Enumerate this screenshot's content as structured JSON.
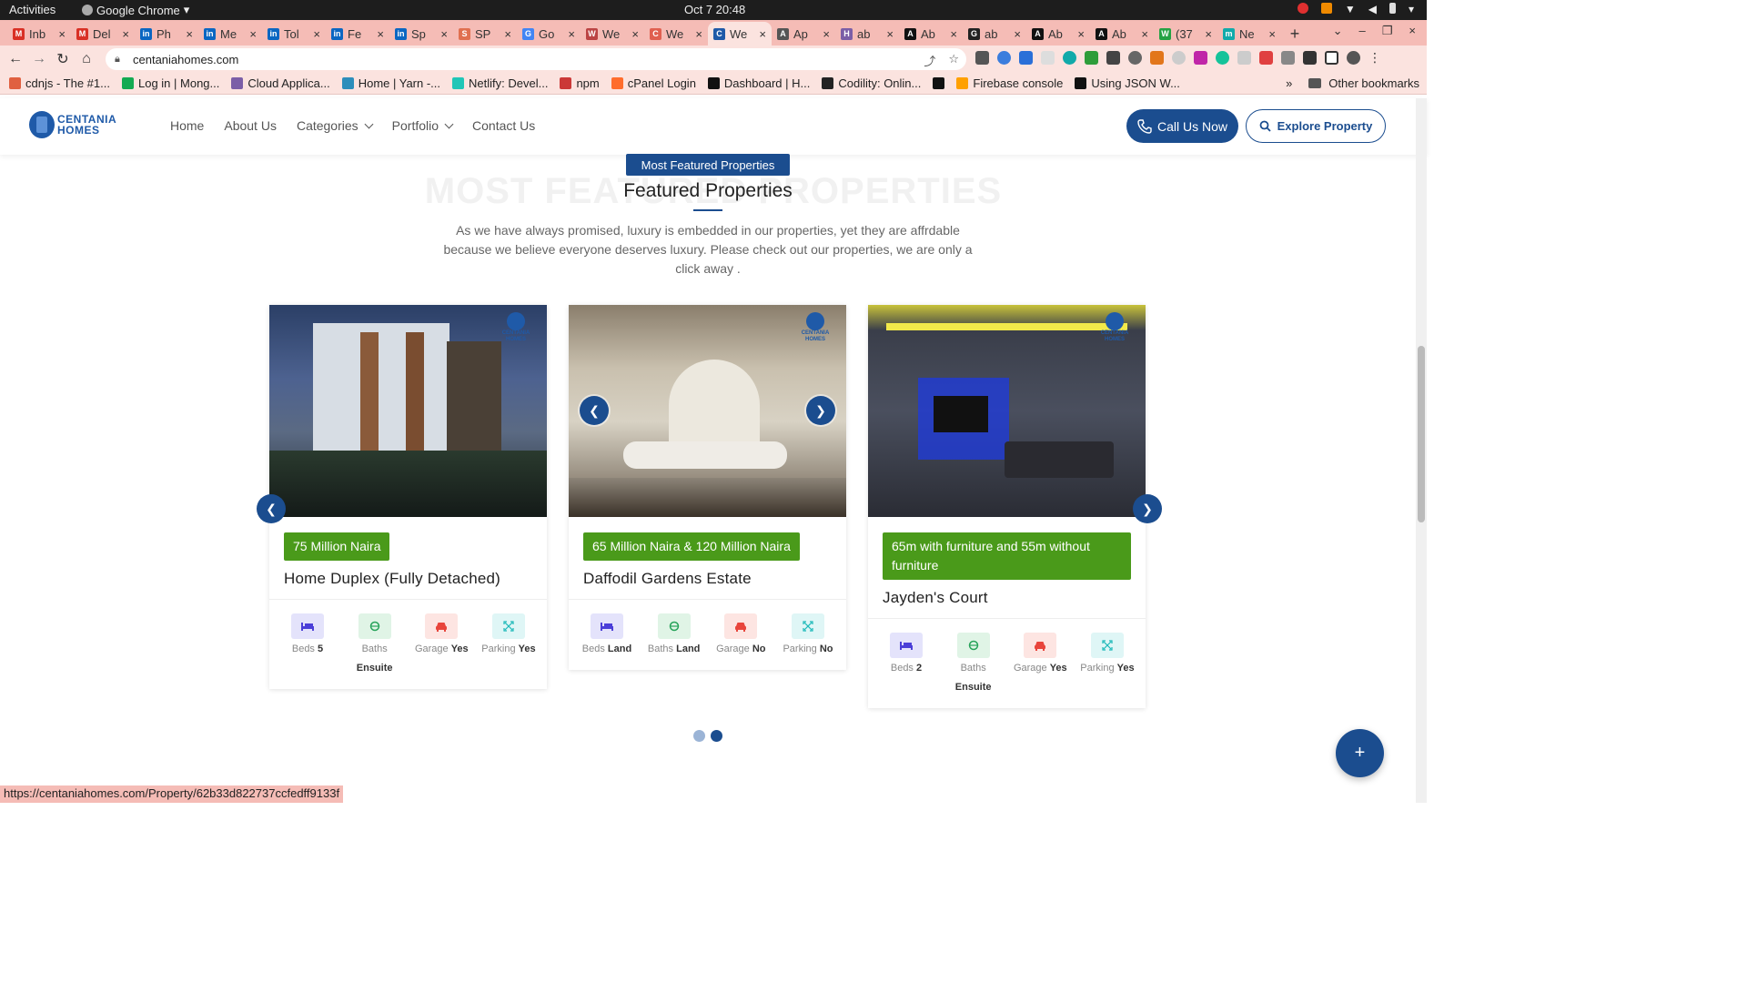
{
  "os": {
    "activities": "Activities",
    "app": "Google Chrome",
    "clock": "Oct 7  20:48"
  },
  "tabs": [
    {
      "label": "Inb",
      "color": "#d93025",
      "glyph": "M"
    },
    {
      "label": "Del",
      "color": "#d93025",
      "glyph": "M"
    },
    {
      "label": "Ph",
      "color": "#0a66c2",
      "glyph": "in"
    },
    {
      "label": "Me",
      "color": "#0a66c2",
      "glyph": "in"
    },
    {
      "label": "Tol",
      "color": "#0a66c2",
      "glyph": "in"
    },
    {
      "label": "Fe",
      "color": "#0a66c2",
      "glyph": "in"
    },
    {
      "label": "Sp",
      "color": "#0a66c2",
      "glyph": "in"
    },
    {
      "label": "SP",
      "color": "#e07050",
      "glyph": "S"
    },
    {
      "label": "Go",
      "color": "#4285f4",
      "glyph": "G"
    },
    {
      "label": "We",
      "color": "#b44",
      "glyph": "W"
    },
    {
      "label": "We",
      "color": "#e06050",
      "glyph": "C"
    },
    {
      "label": "We",
      "color": "#1f5aa8",
      "glyph": "C",
      "active": true
    },
    {
      "label": "Ap",
      "color": "#555",
      "glyph": "A"
    },
    {
      "label": "ab",
      "color": "#7b5ea7",
      "glyph": "H"
    },
    {
      "label": "Ab",
      "color": "#111",
      "glyph": "A"
    },
    {
      "label": "ab",
      "color": "#222",
      "glyph": "G"
    },
    {
      "label": "Ab",
      "color": "#111",
      "glyph": "A"
    },
    {
      "label": "Ab",
      "color": "#111",
      "glyph": "A"
    },
    {
      "label": "(37",
      "color": "#25a244",
      "glyph": "W"
    },
    {
      "label": "Ne",
      "color": "#1aa",
      "glyph": "m"
    }
  ],
  "toolbar": {
    "url": "centaniahomes.com"
  },
  "bookmarks": [
    {
      "label": "cdnjs - The #1...",
      "color": "#e06040"
    },
    {
      "label": "Log in | Mong...",
      "color": "#13aa52"
    },
    {
      "label": "Cloud Applica...",
      "color": "#7b5ea7"
    },
    {
      "label": "Home | Yarn -...",
      "color": "#2c8ebb"
    },
    {
      "label": "Netlify: Devel...",
      "color": "#20c6b7"
    },
    {
      "label": "npm",
      "color": "#cb3837"
    },
    {
      "label": "cPanel Login",
      "color": "#ff6c2c"
    },
    {
      "label": "Dashboard | H...",
      "color": "#111"
    },
    {
      "label": "Codility: Onlin...",
      "color": "#222"
    },
    {
      "label": "",
      "color": "#111"
    },
    {
      "label": "Firebase console",
      "color": "#ffa000"
    },
    {
      "label": "Using JSON W...",
      "color": "#111"
    }
  ],
  "bookmarks_more": "»",
  "other_bookmarks": "Other bookmarks",
  "site": {
    "logo_line1": "CENTANIA",
    "logo_line2": "HOMES",
    "nav": [
      "Home",
      "About Us",
      "Categories",
      "Portfolio",
      "Contact Us"
    ],
    "call_label": "Call Us Now",
    "explore_label": "Explore Property"
  },
  "section": {
    "badge": "Most Featured Properties",
    "ghost": "MOST FEATURED PROPERTIES",
    "title": "Featured Properties",
    "description": "As we have always promised, luxury is embedded in our properties, yet they are affrdable because we believe everyone deserves luxury. Please check out our properties, we are only a click away ."
  },
  "cards": [
    {
      "price": "75 Million Naira",
      "title": "Home Duplex (Fully Detached)",
      "beds_label": "Beds",
      "beds": "5",
      "baths_label": "Baths",
      "baths": "Ensuite",
      "garage_label": "Garage",
      "garage": "Yes",
      "parking_label": "Parking",
      "parking": "Yes"
    },
    {
      "price": "65 Million Naira & 120 Million Naira",
      "title": "Daffodil Gardens Estate",
      "beds_label": "Beds",
      "beds": "Land",
      "baths_label": "Baths",
      "baths": "Land",
      "garage_label": "Garage",
      "garage": "No",
      "parking_label": "Parking",
      "parking": "No"
    },
    {
      "price": "65m with furniture and 55m without furniture",
      "title": "Jayden's Court",
      "beds_label": "Beds",
      "beds": "2",
      "baths_label": "Baths",
      "baths": "Ensuite",
      "garage_label": "Garage",
      "garage": "Yes",
      "parking_label": "Parking",
      "parking": "Yes"
    }
  ],
  "watermark": {
    "line1": "CENTANIA",
    "line2": "HOMES"
  },
  "fab_label": "+",
  "status_url": "https://centaniahomes.com/Property/62b33d822737ccfedff9133f"
}
